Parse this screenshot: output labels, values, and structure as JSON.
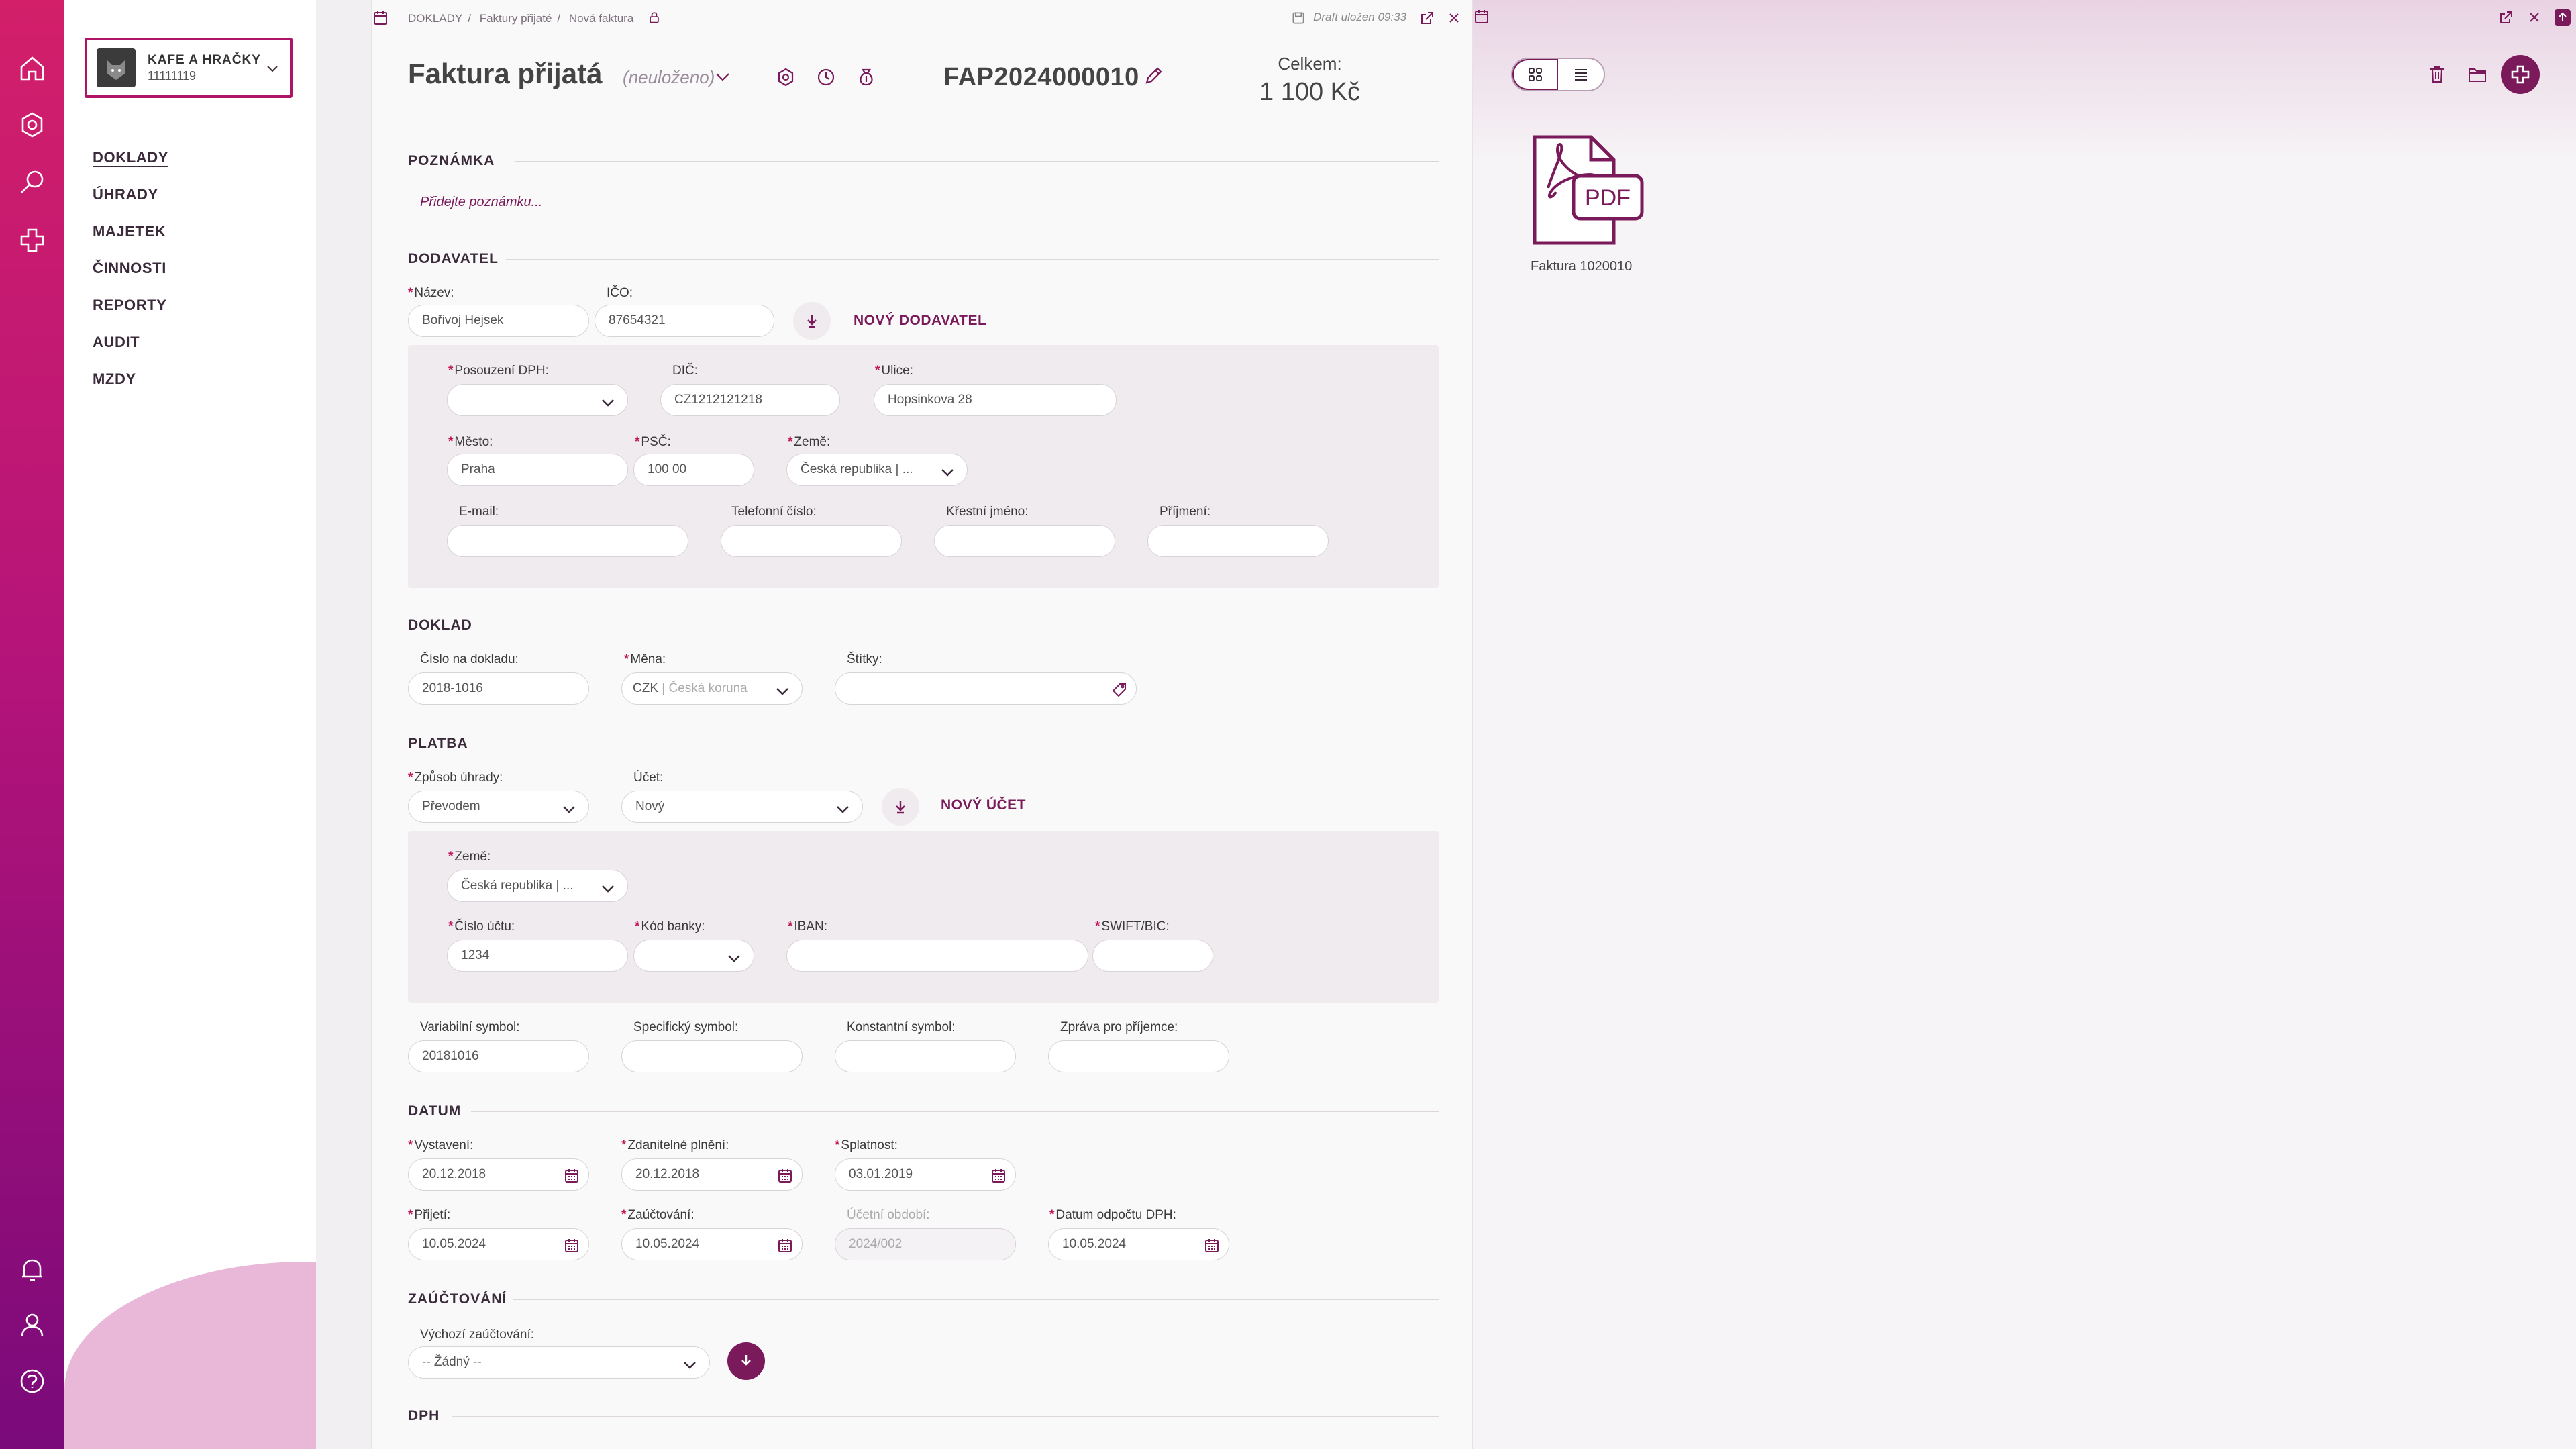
{
  "sidebar": {
    "company_name": "KAFE A HRAČKY",
    "company_id": "11111119",
    "nav": [
      "DOKLADY",
      "ÚHRADY",
      "MAJETEK",
      "ČINNOSTI",
      "REPORTY",
      "AUDIT",
      "MZDY"
    ]
  },
  "topbar": {
    "breadcrumb": [
      "DOKLADY",
      "Faktury přijaté",
      "Nová faktura"
    ],
    "draft": "Draft uložen 09:33"
  },
  "header": {
    "title": "Faktura přijatá",
    "status": "(neuloženo)",
    "doc_number": "FAP2024000010",
    "total_label": "Celkem:",
    "total_value": "1 100 Kč"
  },
  "note": {
    "section": "POZNÁMKA",
    "placeholder": "Přidejte poznámku..."
  },
  "supplier": {
    "section": "DODAVATEL",
    "name_label": "Název:",
    "name_value": "Bořivoj Hejsek",
    "ico_label": "IČO:",
    "ico_value": "87654321",
    "new_supplier": "NOVÝ DODAVATEL",
    "vat_label": "Posouzení DPH:",
    "vat_value": "",
    "dic_label": "DIČ:",
    "dic_value": "CZ1212121218",
    "street_label": "Ulice:",
    "street_value": "Hopsinkova 28",
    "city_label": "Město:",
    "city_value": "Praha",
    "psc_label": "PSČ:",
    "psc_value": "100  00",
    "country_label": "Země:",
    "country_value": "Česká republika | ...",
    "email_label": "E-mail:",
    "phone_label": "Telefonní číslo:",
    "firstname_label": "Křestní jméno:",
    "lastname_label": "Příjmení:"
  },
  "document": {
    "section": "DOKLAD",
    "number_label": "Číslo na dokladu:",
    "number_value": "2018-1016",
    "currency_label": "Měna:",
    "currency_code": "CZK",
    "currency_name": "| Česká koruna",
    "tags_label": "Štítky:"
  },
  "payment": {
    "section": "PLATBA",
    "method_label": "Způsob úhrady:",
    "method_value": "Převodem",
    "account_label": "Účet:",
    "account_value": "Nový",
    "new_account": "NOVÝ ÚČET",
    "country_label": "Země:",
    "country_value": "Česká republika | ...",
    "accno_label": "Číslo účtu:",
    "accno_value": "1234",
    "bank_label": "Kód banky:",
    "iban_label": "IBAN:",
    "swift_label": "SWIFT/BIC:",
    "vs_label": "Variabilní symbol:",
    "vs_value": "20181016",
    "ss_label": "Specifický symbol:",
    "ks_label": "Konstantní symbol:",
    "msg_label": "Zpráva pro příjemce:"
  },
  "dates": {
    "section": "DATUM",
    "issued_label": "Vystavení:",
    "issued_value": "20.12.2018",
    "taxable_label": "Zdanitelné plnění:",
    "taxable_value": "20.12.2018",
    "due_label": "Splatnost:",
    "due_value": "03.01.2019",
    "received_label": "Přijetí:",
    "received_value": "10.05.2024",
    "posted_label": "Zaúčtování:",
    "posted_value": "10.05.2024",
    "period_label": "Účetní období:",
    "period_value": "2024/002",
    "vat_date_label": "Datum odpočtu DPH:",
    "vat_date_value": "10.05.2024"
  },
  "posting": {
    "section": "ZAÚČTOVÁNÍ",
    "default_label": "Výchozí zaúčtování:",
    "default_value": "-- Žádný --"
  },
  "vat": {
    "section": "DPH"
  },
  "attachments": {
    "file_name": "Faktura 1020010",
    "file_badge": "PDF"
  }
}
